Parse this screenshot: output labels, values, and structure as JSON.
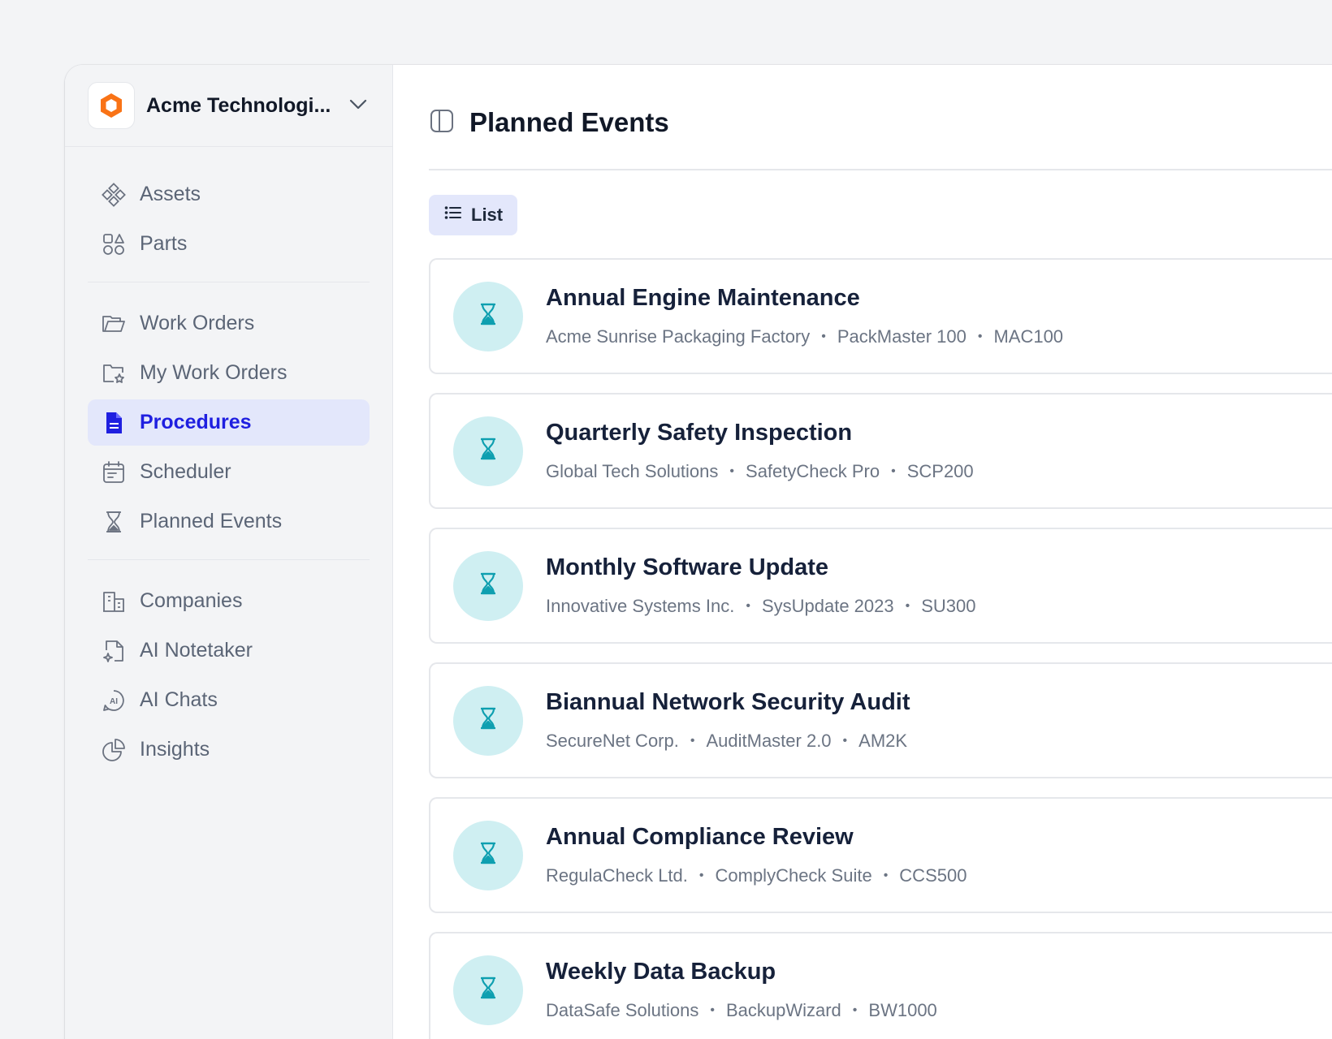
{
  "org": {
    "name": "Acme Technologi..."
  },
  "sidebar": {
    "groups": [
      [
        {
          "label": "Assets",
          "icon": "assets-icon"
        },
        {
          "label": "Parts",
          "icon": "parts-icon"
        }
      ],
      [
        {
          "label": "Work Orders",
          "icon": "folder-icon"
        },
        {
          "label": "My Work Orders",
          "icon": "folder-star-icon"
        },
        {
          "label": "Procedures",
          "icon": "document-icon",
          "active": true
        },
        {
          "label": "Scheduler",
          "icon": "calendar-icon"
        },
        {
          "label": "Planned Events",
          "icon": "hourglass-icon"
        }
      ],
      [
        {
          "label": "Companies",
          "icon": "building-icon"
        },
        {
          "label": "AI Notetaker",
          "icon": "note-sparkle-icon"
        },
        {
          "label": "AI Chats",
          "icon": "ai-chat-icon"
        },
        {
          "label": "Insights",
          "icon": "pie-chart-icon"
        }
      ]
    ]
  },
  "header": {
    "title": "Planned Events"
  },
  "toolbar": {
    "view_label": "List"
  },
  "events": [
    {
      "title": "Annual Engine Maintenance",
      "company": "Acme Sunrise Packaging Factory",
      "asset": "PackMaster 100",
      "code": "MAC100"
    },
    {
      "title": "Quarterly Safety Inspection",
      "company": "Global Tech Solutions",
      "asset": "SafetyCheck Pro",
      "code": "SCP200"
    },
    {
      "title": "Monthly Software Update",
      "company": "Innovative Systems Inc.",
      "asset": "SysUpdate 2023",
      "code": "SU300"
    },
    {
      "title": "Biannual Network Security Audit",
      "company": "SecureNet Corp.",
      "asset": "AuditMaster 2.0",
      "code": "AM2K"
    },
    {
      "title": "Annual Compliance Review",
      "company": "RegulaCheck Ltd.",
      "asset": "ComplyCheck Suite",
      "code": "CCS500"
    },
    {
      "title": "Weekly Data Backup",
      "company": "DataSafe Solutions",
      "asset": "BackupWizard",
      "code": "BW1000"
    }
  ],
  "colors": {
    "accent": "#1f1fe0",
    "active_bg": "#e3e7fb",
    "event_icon_bg": "#cfeff2",
    "event_icon": "#0e9fb0",
    "logo": "#f97316"
  }
}
